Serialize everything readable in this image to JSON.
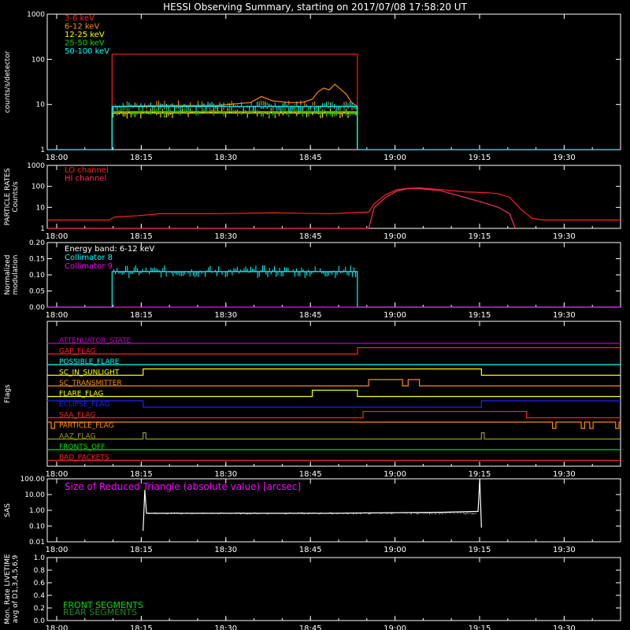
{
  "title": "HESSI Observing Summary, starting on 2017/07/08 17:58:20 UT",
  "colors": {
    "background": "#000000",
    "axes": "#ffffff",
    "red": "#ff2020",
    "orange": "#ff8c00",
    "yellow": "#ffff00",
    "green": "#00e000",
    "cyan": "#00ffff",
    "magenta": "#ff00ff",
    "crimson": "#ff3060",
    "blue": "#2020ff",
    "olive": "#9a9a20",
    "dark_green": "#228b22"
  },
  "time_axis": {
    "start": "17:58:20",
    "range_minutes": [
      0,
      101.67
    ],
    "tick_labels": [
      "18:00",
      "18:15",
      "18:30",
      "18:45",
      "19:00",
      "19:15",
      "19:30"
    ],
    "tick_minutes": [
      1.67,
      16.67,
      31.67,
      46.67,
      61.67,
      76.67,
      91.67
    ]
  },
  "chart_data": [
    {
      "type": "line",
      "panel": "count_rates",
      "ylabel": "counts/s/detector",
      "yscale": "log",
      "ylim": [
        1,
        1000
      ],
      "ytick_labels": [
        "1",
        "10",
        "100",
        "1000"
      ],
      "ytick_values": [
        1,
        10,
        100,
        1000
      ],
      "series": [
        {
          "name": "3-6 keV",
          "color": "#ff2020",
          "x": [
            0,
            11.5,
            11.5,
            55.0,
            55.0,
            101.67
          ],
          "y": [
            1,
            1,
            130,
            130,
            1,
            1
          ]
        },
        {
          "name": "6-12 keV",
          "color": "#ff8c00",
          "x": [
            11.5,
            11.5,
            20,
            30,
            36,
            38,
            40,
            43,
            45,
            47,
            48,
            49,
            50,
            51,
            52,
            53,
            54,
            55.0,
            55.0
          ],
          "y": [
            1,
            9,
            9.5,
            9.5,
            11,
            15,
            12,
            11,
            11,
            13,
            19,
            23,
            21,
            28,
            22,
            17,
            11,
            9,
            1
          ]
        },
        {
          "name": "12-25 keV",
          "color": "#ffff00",
          "x": [
            11.5,
            11.5,
            55.0,
            55.0
          ],
          "y": [
            1,
            6.5,
            6.5,
            1
          ]
        },
        {
          "name": "25-50 keV",
          "color": "#00e000",
          "x": [
            11.5,
            11.5,
            55.0,
            55.0
          ],
          "y": [
            1,
            7.0,
            7.0,
            1
          ]
        },
        {
          "name": "50-100 keV",
          "color": "#00ffff",
          "x": [
            0,
            11.5,
            11.5,
            55.0,
            55.0,
            101.67
          ],
          "y": [
            1,
            1,
            9,
            9,
            1,
            1
          ]
        }
      ]
    },
    {
      "type": "line",
      "panel": "particle_rates",
      "ylabel": "PARTICLE RATES",
      "ylabel2": "Counts/s",
      "yscale": "log",
      "ylim": [
        1,
        1000
      ],
      "ytick_labels": [
        "1",
        "10",
        "100",
        "1000"
      ],
      "ytick_values": [
        1,
        10,
        100,
        1000
      ],
      "series": [
        {
          "name": "LO channel",
          "color": "#ff2020",
          "x": [
            0,
            11,
            12,
            16,
            20,
            30,
            40,
            50,
            57,
            58,
            60,
            62,
            64,
            66,
            70,
            74,
            78,
            80,
            82,
            84,
            86,
            88,
            90,
            95,
            101.67
          ],
          "y": [
            2.5,
            2.5,
            3.5,
            4,
            5,
            5,
            5.5,
            5,
            6,
            15,
            40,
            70,
            80,
            85,
            70,
            55,
            50,
            45,
            30,
            8,
            3,
            2.5,
            2.5,
            2.5,
            2.5
          ]
        },
        {
          "name": "HI channel",
          "color": "#ff3060",
          "x": [
            0,
            57,
            58,
            60,
            62,
            64,
            66,
            70,
            74,
            78,
            80,
            82,
            83
          ],
          "y": [
            1,
            1,
            10,
            30,
            60,
            80,
            80,
            60,
            30,
            15,
            10,
            5,
            1
          ]
        }
      ]
    },
    {
      "type": "line",
      "panel": "modulation",
      "ylabel": "Normalized",
      "ylabel2": "modulation",
      "ylim": [
        0.0,
        0.2
      ],
      "ytick_labels": [
        "0.00",
        "0.05",
        "0.10",
        "0.15",
        "0.20"
      ],
      "ytick_values": [
        0.0,
        0.05,
        0.1,
        0.15,
        0.2
      ],
      "annotation": "Energy band: 6-12 keV",
      "series": [
        {
          "name": "Collimator 8",
          "color": "#00ffff",
          "x": [
            0,
            11.5,
            11.5,
            55.0,
            55.0,
            101.67
          ],
          "y": [
            0,
            0,
            0.11,
            0.11,
            0,
            0
          ]
        },
        {
          "name": "Collimator 9",
          "color": "#ff00ff",
          "x": [
            0,
            101.67
          ],
          "y": [
            0,
            0
          ]
        }
      ]
    },
    {
      "type": "line",
      "panel": "flags",
      "ylabel": "Flags",
      "series": [
        {
          "name": "ATTENUATOR_STATE",
          "color": "#c000c0",
          "x": [
            0,
            101.67
          ],
          "y": [
            0,
            0
          ]
        },
        {
          "name": "GAP_FLAG",
          "color": "#ff2020",
          "x": [
            0,
            55,
            55,
            101.67
          ],
          "y": [
            0,
            0,
            1,
            1
          ]
        },
        {
          "name": "POSSIBLE_FLARE",
          "color": "#00ffff",
          "x": [
            0,
            101.67
          ],
          "y": [
            0,
            0
          ]
        },
        {
          "name": "SC_IN_SUNLIGHT",
          "color": "#ffff00",
          "x": [
            0,
            17,
            17,
            77,
            77,
            101.67
          ],
          "y": [
            0,
            0,
            1,
            1,
            0,
            0
          ]
        },
        {
          "name": "SC_TRANSMITTER",
          "color": "#ff8c00",
          "x": [
            0,
            57,
            57,
            63,
            63,
            64,
            64,
            66,
            66,
            101.67
          ],
          "y": [
            0,
            0,
            1,
            1,
            0,
            0,
            1,
            1,
            0,
            0
          ]
        },
        {
          "name": "FLARE_FLAG",
          "color": "#ffff00",
          "x": [
            0,
            47,
            47,
            55,
            55,
            101.67
          ],
          "y": [
            0,
            0,
            1,
            1,
            0,
            0
          ]
        },
        {
          "name": "ECLIPSE_FLAG",
          "color": "#2020ff",
          "x": [
            0,
            17,
            17,
            77,
            77,
            101.67
          ],
          "y": [
            1,
            1,
            0,
            0,
            1,
            1
          ]
        },
        {
          "name": "SAA_FLAG",
          "color": "#ff2020",
          "x": [
            0,
            56,
            56,
            85,
            85,
            101.67
          ],
          "y": [
            0,
            0,
            1,
            1,
            0,
            0
          ]
        },
        {
          "name": "PARTICLE_FLAG",
          "color": "#ff8c00",
          "x": [
            0,
            0.7,
            0.7,
            1.3,
            1.3,
            89.6,
            89.6,
            90.2,
            90.2,
            94.7,
            94.7,
            95.3,
            95.3,
            96.2,
            96.2,
            96.8,
            96.8,
            100.8,
            100.8,
            101.4,
            101.4,
            101.67
          ],
          "y": [
            1,
            1,
            0,
            0,
            1,
            1,
            0,
            0,
            1,
            1,
            0,
            0,
            1,
            1,
            0,
            0,
            1,
            1,
            0,
            0,
            1,
            1
          ]
        },
        {
          "name": "AAZ_FLAG",
          "color": "#9a9a20",
          "x": [
            0,
            17,
            17,
            17.5,
            17.5,
            77,
            77,
            77.5,
            77.5,
            101.67
          ],
          "y": [
            0,
            0,
            1,
            1,
            0,
            0,
            1,
            1,
            0,
            0
          ]
        },
        {
          "name": "FRONTS_OFF",
          "color": "#00e000",
          "x": [
            0,
            101.67
          ],
          "y": [
            0,
            0
          ]
        },
        {
          "name": "BAD_PACKETS",
          "color": "#ff2020",
          "x": [
            0,
            101.67
          ],
          "y": [
            0,
            0
          ]
        }
      ]
    },
    {
      "type": "line",
      "panel": "sas",
      "ylabel": "SAS",
      "yscale": "log",
      "ylim": [
        0.01,
        100
      ],
      "ytick_labels": [
        "0.01",
        "0.10",
        "1.00",
        "10.00",
        "100.00"
      ],
      "ytick_values": [
        0.01,
        0.1,
        1,
        10,
        100
      ],
      "annotation": "Size of Reduced Triangle (absolute value) [arcsec]",
      "series": [
        {
          "name": "Size of Reduced Triangle",
          "color": "#ffffff",
          "x": [
            17,
            17.3,
            17.6,
            20,
            30,
            40,
            50,
            60,
            70,
            76.4,
            76.7,
            77
          ],
          "y": [
            0.05,
            20,
            0.65,
            0.65,
            0.65,
            0.65,
            0.65,
            0.7,
            0.75,
            0.85,
            100,
            0.08
          ]
        }
      ]
    },
    {
      "type": "line",
      "panel": "livetime",
      "ylabel": "Mon. Rate LIVETIME",
      "ylabel2": "avg of D1,3,4,5,6,9",
      "ylim": [
        0.0,
        1.0
      ],
      "ytick_labels": [
        "0.0",
        "0.2",
        "0.4",
        "0.6",
        "0.8",
        "1.0"
      ],
      "ytick_values": [
        0.0,
        0.2,
        0.4,
        0.6,
        0.8,
        1.0
      ],
      "series": [
        {
          "name": "FRONT SEGMENTS",
          "color": "#00e000",
          "x": [],
          "y": []
        },
        {
          "name": "REAR SEGMENTS",
          "color": "#228b22",
          "x": [],
          "y": []
        }
      ]
    }
  ]
}
